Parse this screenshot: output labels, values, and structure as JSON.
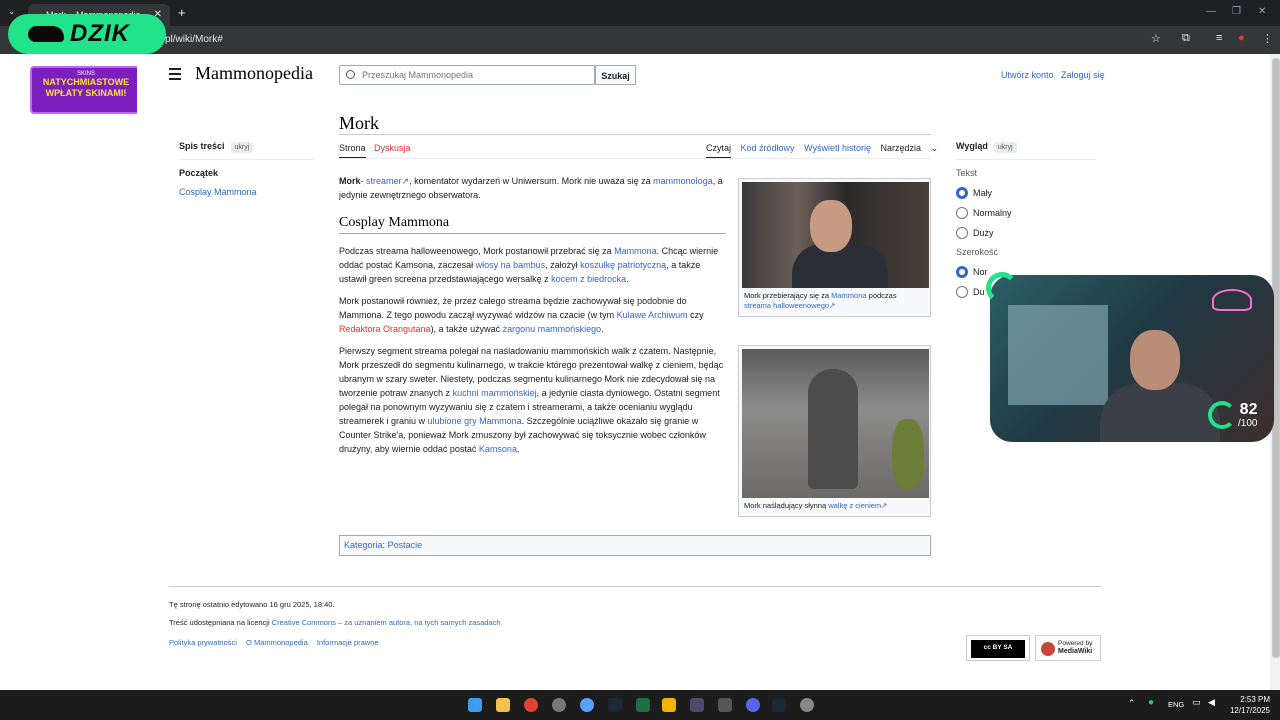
{
  "browser": {
    "tab_title": "Mork – Mammonopedia",
    "tab_close": "✕",
    "new_tab": "+",
    "url": "pl/wiki/Mork#"
  },
  "overlay": {
    "dzik": "DZIK",
    "promo_brand": "SKINS",
    "promo_line1": "NATYCHMIASTOWE",
    "promo_line2": "WPŁATY SKINAMI!",
    "cam_score": "82",
    "cam_max": "/100"
  },
  "header": {
    "logo": "Mammonopedia",
    "search_placeholder": "Przeszukaj Mammonopedia",
    "search_button": "Szukaj",
    "create_account": "Utwórz konto",
    "login": "Zaloguj się"
  },
  "article": {
    "title": "Mork",
    "tab_page": "Strona",
    "tab_talk": "Dyskusja",
    "tab_read": "Czytaj",
    "tab_source": "Kod źródłowy",
    "tab_history": "Wyświetl historię",
    "tab_tools": "Narzędzia",
    "intro_bold": "Mork",
    "intro_a": "- ",
    "intro_link1": "streamer",
    "intro_b": ", komentator wydarzeń w Uniwersum. Mork nie uważa się za ",
    "intro_link2": "mammonologa",
    "intro_c": ", a jedynie zewnętrznego obserwatora.",
    "h2": "Cosplay Mammona",
    "p1_a": "Podczas streama halloweenowego, Mork postanowił przebrać się za ",
    "p1_link1": "Mammona",
    "p1_b": ". Chcąc wiernie oddać postać Kamsona, zaczesał ",
    "p1_link2": "włosy na bambus",
    "p1_c": ", założył ",
    "p1_link3": "koszulkę patriotyczną",
    "p1_d": ", a także ustawił green screena przedstawiającego wersalkę z ",
    "p1_link4": "kocem z biedrocka",
    "p1_e": ".",
    "p2_a": "Mork postanowił również, że przez całego streama będzie zachowywał się podobnie do Mammona. Z tego powodu zaczął wyzywać widzów na czacie (w tym ",
    "p2_link1": "Kulawe Archiwum",
    "p2_b": " czy ",
    "p2_link2": "Redaktora Orangutana",
    "p2_c": "), a także używać ",
    "p2_link3": "żargonu mammońskiego",
    "p2_d": ".",
    "p3_a": "Pierwszy segment streama polegał na naśladowaniu mammońskich walk z czatem. Następnie, Mork przeszedł do segmentu kulinarnego, w trakcie którego prezentował walkę z cieniem, będąc ubranym w szary sweter. Niestety, podczas segmentu kulinarnego Mork nie zdecydował się na tworzenie potraw znanych z ",
    "p3_link1": "kuchni mammońskiej",
    "p3_b": ", a jedynie ciasta dyniowego. Ostatni segment polegał na ponownym wyzywaniu się z czatem i streamerami, a także ocenianiu wyglądu streamerek i graniu w ",
    "p3_link2": "ulubione gry Mammona",
    "p3_c": ". Szczególnie uciążliwe okazało się granie w Counter Strike'a, ponieważ Mork zmuszony był zachowywać się toksycznie wobec członków drużyny, aby wiernie oddać postać ",
    "p3_link3": "Kamsona",
    "p3_d": ".",
    "cap1_a": "Mork przebierający się za ",
    "cap1_link1": "Mammona",
    "cap1_b": " podczas ",
    "cap1_link2": "streama halloweenowego",
    "cap2_a": "Mork naśladujący słynną ",
    "cap2_link": "walkę z cieniem",
    "category_label": "Kategoria",
    "category_sep": ":",
    "category_value": "Postacie"
  },
  "toc": {
    "title": "Spis treści",
    "hide": "ukryj",
    "items": [
      "Początek",
      "Cosplay Mammona"
    ]
  },
  "appearance": {
    "title": "Wygląd",
    "hide": "ukryj",
    "text_label": "Tekst",
    "text_options": [
      "Mały",
      "Normalny",
      "Duży"
    ],
    "width_label": "Szerokość",
    "width_options": [
      "Nor",
      "Du"
    ]
  },
  "footer": {
    "edited": "Tę stronę ostatnio edytowano 16 gru 2025, 18:40.",
    "license_a": "Treść udostępniana na licencji ",
    "license_link": "Creative Commons – za uznaniem autora, na tych samych zasadach",
    "privacy": "Polityka prywatności",
    "about": "O Mammonopedia",
    "legal": "Informacje prawne",
    "cc_badge": "cc BY SA",
    "mw_badge_1": "Powered by",
    "mw_badge_2": "MediaWiki"
  },
  "taskbar": {
    "lang": "ENG",
    "time": "2:53 PM",
    "date": "12/17/2025"
  }
}
